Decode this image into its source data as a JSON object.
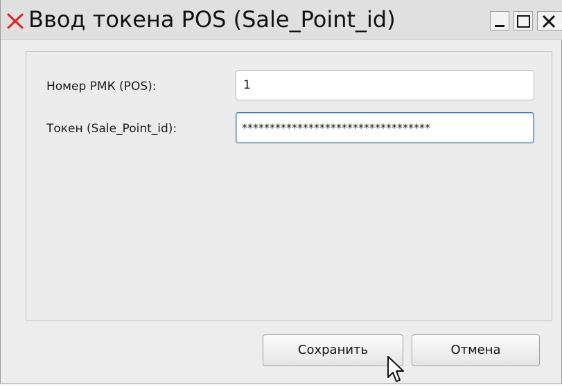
{
  "window": {
    "title": "Ввод токена POS (Sale_Point_id)",
    "icons": {
      "app": "red-x-app-icon",
      "minimize": "minimize-icon",
      "maximize": "maximize-icon",
      "close": "close-icon"
    }
  },
  "form": {
    "pos_label": "Номер РМК (POS):",
    "pos_value": "1",
    "token_label": "Токен (Sale_Point_id):",
    "token_value": "**********************************"
  },
  "buttons": {
    "save_label": "Сохранить",
    "cancel_label": "Отмена"
  },
  "colors": {
    "app_icon": "#e02020",
    "focus_border": "#3d7fbd",
    "window_bg": "#ededed"
  },
  "pointer": "arrow-cursor-icon"
}
